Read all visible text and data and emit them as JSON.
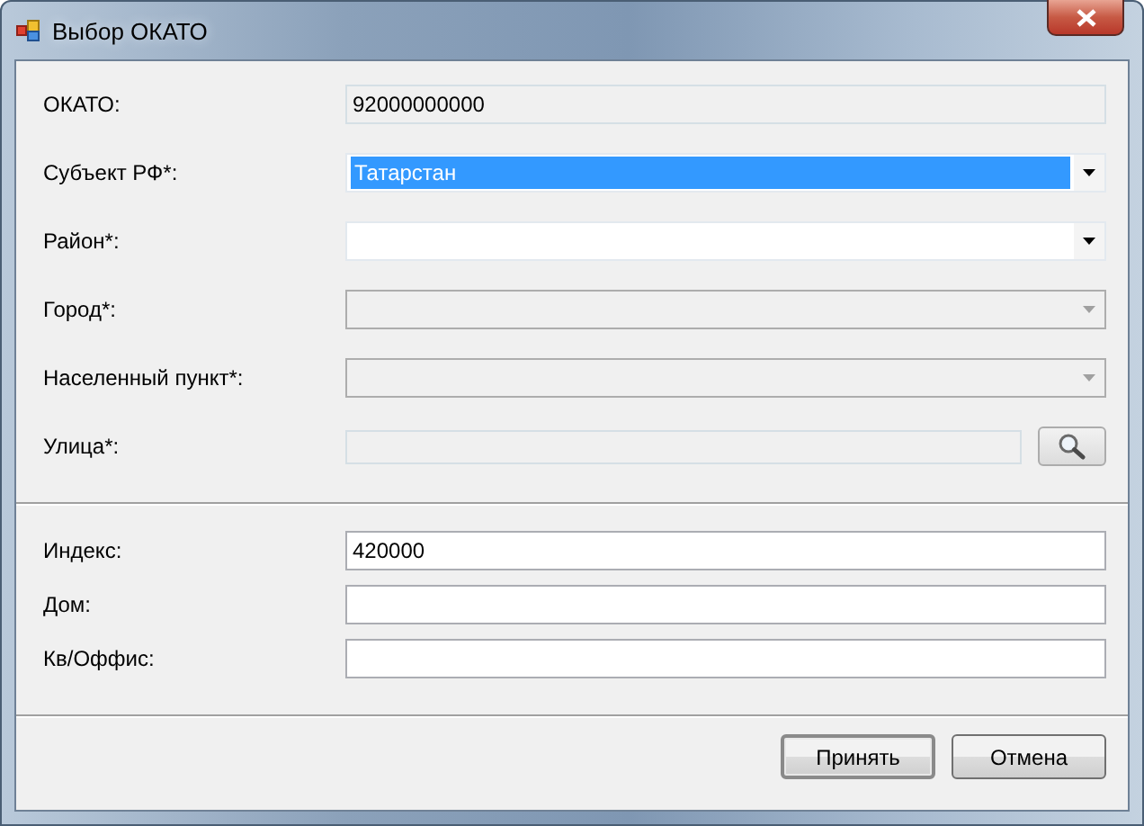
{
  "window": {
    "title": "Выбор ОКАТО"
  },
  "sections": [
    {
      "fields": [
        {
          "label": "ОКАТО:",
          "kind": "text",
          "value": "92000000000",
          "disabled": true,
          "focused": false
        },
        {
          "label": "Субъект РФ*:",
          "kind": "combo",
          "value": "Татарстан",
          "disabled": false,
          "focused": true
        },
        {
          "label": "Район*:",
          "kind": "combo",
          "disabled": false,
          "focused": false
        },
        {
          "label": "Город*:",
          "kind": "combo",
          "disabled": true,
          "focused": false
        },
        {
          "label": "Населенный пункт*:",
          "kind": "combo",
          "disabled": true,
          "focused": false
        },
        {
          "label": "Улица*:",
          "kind": "search",
          "disabled": true,
          "focused": false
        }
      ]
    },
    {
      "fields": [
        {
          "label": "Индекс:",
          "kind": "text",
          "value": "420000",
          "disabled": false,
          "focused": false
        },
        {
          "label": "Дом:",
          "kind": "text",
          "disabled": false,
          "focused": false
        },
        {
          "label": "Кв/Оффис:",
          "kind": "text",
          "disabled": false,
          "focused": false
        }
      ]
    }
  ],
  "buttons": [
    {
      "label": "Принять",
      "default": true
    },
    {
      "label": "Отмена",
      "default": false
    }
  ]
}
